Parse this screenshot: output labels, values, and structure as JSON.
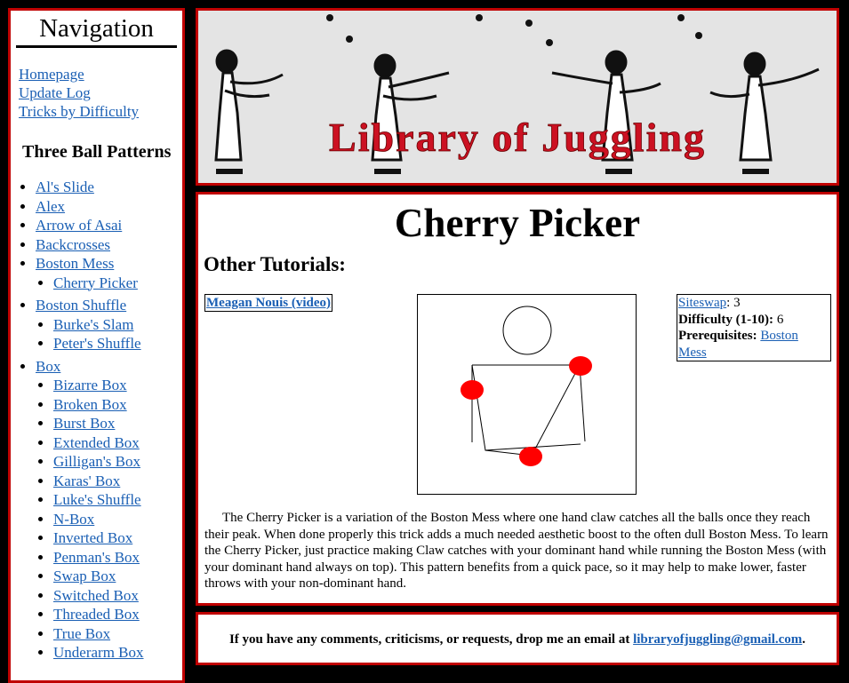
{
  "nav": {
    "title": "Navigation",
    "links": [
      "Homepage",
      "Update Log",
      "Tricks by Difficulty"
    ],
    "section": "Three Ball Patterns",
    "patterns": [
      {
        "label": "Al's Slide"
      },
      {
        "label": "Alex"
      },
      {
        "label": "Arrow of Asai"
      },
      {
        "label": "Backcrosses"
      },
      {
        "label": "Boston Mess",
        "children": [
          "Cherry Picker"
        ]
      },
      {
        "label": "Boston Shuffle",
        "children": [
          "Burke's Slam",
          "Peter's Shuffle"
        ]
      },
      {
        "label": "Box",
        "children": [
          "Bizarre Box",
          "Broken Box",
          "Burst Box",
          "Extended Box",
          "Gilligan's Box",
          "Karas' Box",
          "Luke's Shuffle",
          "N-Box",
          "Inverted Box",
          "Penman's Box",
          "Swap Box",
          "Switched Box",
          "Threaded Box",
          "True Box",
          "Underarm Box"
        ]
      }
    ]
  },
  "banner": {
    "title": "Library of Juggling"
  },
  "main": {
    "title": "Cherry Picker",
    "other_tutorials_heading": "Other Tutorials:",
    "tutorial_link": "Meagan Nouis (video)",
    "info": {
      "siteswap_label": "Siteswap",
      "siteswap_value": ": 3",
      "difficulty_label": "Difficulty (1-10):",
      "difficulty_value": " 6",
      "prereq_label": "Prerequisites:",
      "prereq_link": "Boston Mess"
    },
    "description": "The Cherry Picker is a variation of the Boston Mess where one hand claw catches all the balls once they reach their peak. When done properly this trick adds a much needed aesthetic boost to the often dull Boston Mess. To learn the Cherry Picker, just practice making Claw catches with your dominant hand while running the Boston Mess (with your dominant hand always on top). This pattern benefits from a quick pace, so it may help to make lower, faster throws with your non-dominant hand."
  },
  "footer": {
    "text": "If you have any comments, criticisms, or requests, drop me an email at",
    "email": "libraryofjuggling@gmail.com",
    "end": "."
  },
  "colors": {
    "border": "#c00000",
    "link": "#1a5fb4",
    "ball": "#ff0000",
    "banner_title": "#cc1122"
  }
}
